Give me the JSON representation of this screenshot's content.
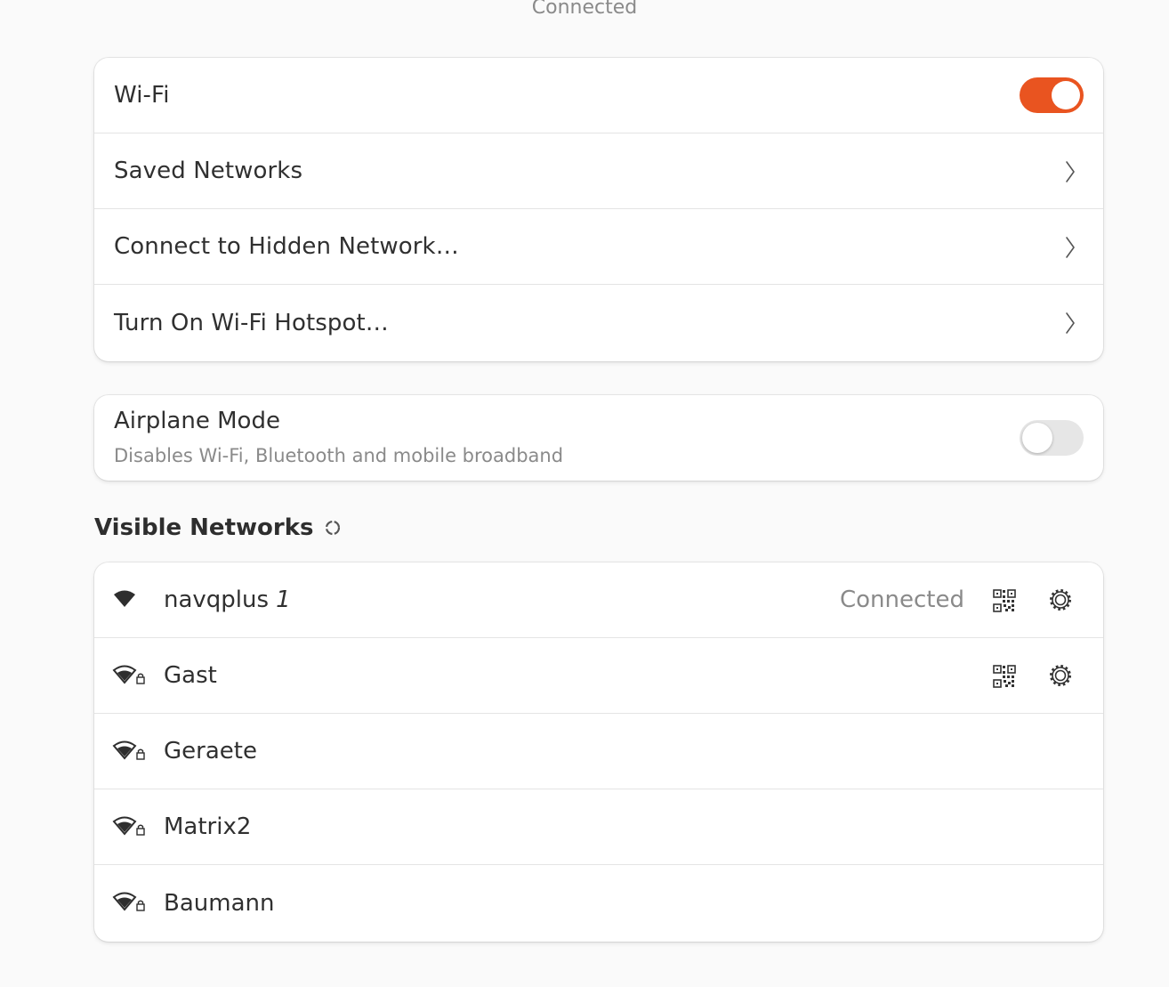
{
  "header": {
    "status": "Connected"
  },
  "wifi_card": {
    "wifi_label": "Wi-Fi",
    "wifi_enabled": true,
    "saved_networks_label": "Saved Networks",
    "hidden_network_label": "Connect to Hidden Network…",
    "hotspot_label": "Turn On Wi-Fi Hotspot…"
  },
  "airplane": {
    "title": "Airplane Mode",
    "subtitle": "Disables Wi-Fi, Bluetooth and mobile broadband",
    "enabled": false
  },
  "visible_networks": {
    "heading": "Visible Networks",
    "networks": [
      {
        "name": "navqplus",
        "suffix": "1",
        "status": "Connected",
        "secured": false,
        "signal": "full"
      },
      {
        "name": "Gast",
        "suffix": "",
        "status": "",
        "secured": true,
        "signal": "medium"
      },
      {
        "name": "Geraete",
        "suffix": "",
        "status": "",
        "secured": true,
        "signal": "medium"
      },
      {
        "name": "Matrix2",
        "suffix": "",
        "status": "",
        "secured": true,
        "signal": "medium"
      },
      {
        "name": "Baumann",
        "suffix": "",
        "status": "",
        "secured": true,
        "signal": "medium"
      }
    ]
  },
  "colors": {
    "accent": "#e95420",
    "toggle_off": "#e6e6e6",
    "secondary_text": "#8a8a8a"
  },
  "icons": {
    "chevron": "chevron-right-icon",
    "qr": "qr-code-icon",
    "settings": "gear-icon",
    "wifi": "wifi-signal-icon",
    "lock": "lock-icon",
    "spinner": "refresh-spinner-icon"
  }
}
